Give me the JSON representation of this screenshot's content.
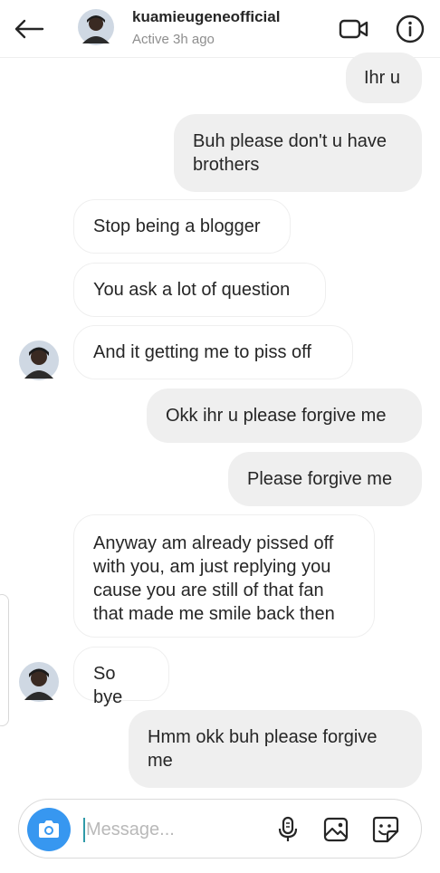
{
  "header": {
    "username": "kuamieugeneofficial",
    "status": "Active 3h ago"
  },
  "messages": [
    {
      "from": "me",
      "text": "Ihr u"
    },
    {
      "from": "me",
      "text": "Buh please don't u have\nbrothers"
    },
    {
      "from": "them",
      "text": "Stop being a blogger"
    },
    {
      "from": "them",
      "text": "You ask a lot of question"
    },
    {
      "from": "them",
      "text": "And it getting me to piss off"
    },
    {
      "from": "me",
      "text": "Okk ihr u please forgive me"
    },
    {
      "from": "me",
      "text": "Please forgive me"
    },
    {
      "from": "them",
      "text": "Anyway am already pissed off\nwith you, am just replying you\ncause you are still of that fan\nthat made me smile back then"
    },
    {
      "from": "them",
      "text": "So bye"
    },
    {
      "from": "me",
      "text": "Hmm okk buh please forgive\nme"
    }
  ],
  "composer": {
    "placeholder": "Message..."
  },
  "colors": {
    "outgoing_bubble": "#efefef",
    "incoming_border": "#efefef",
    "accent_blue": "#3797f0",
    "secondary_text": "#8e8e8e"
  },
  "icons": {
    "back": "arrow-left-icon",
    "video": "video-camera-icon",
    "info": "info-icon",
    "camera": "camera-icon",
    "microphone": "microphone-icon",
    "gallery": "gallery-icon",
    "sticker": "sticker-icon"
  }
}
